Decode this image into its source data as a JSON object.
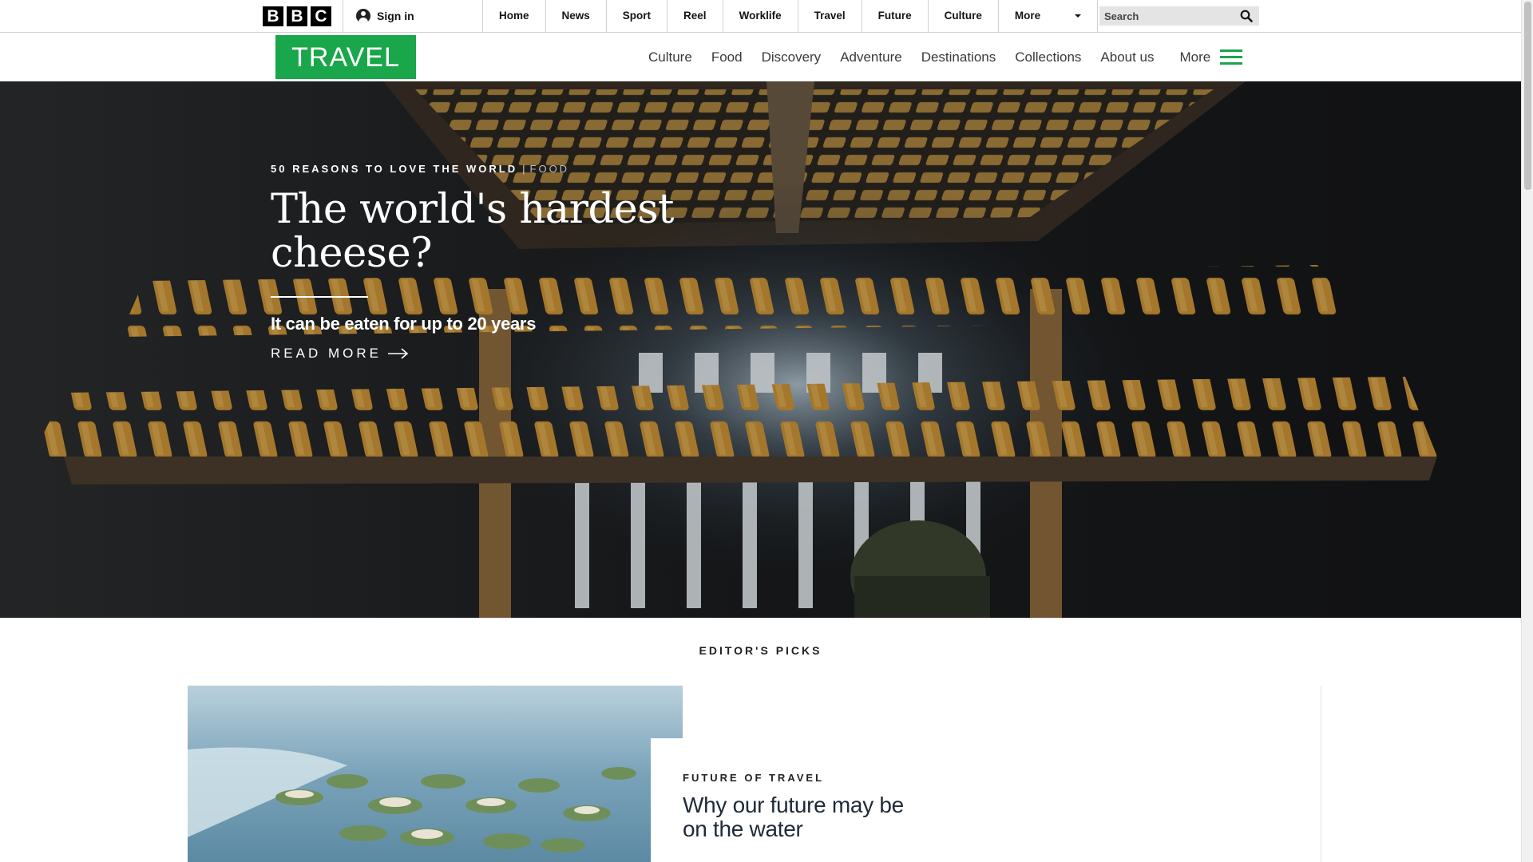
{
  "global_bar": {
    "logo_letters": [
      "B",
      "B",
      "C"
    ],
    "signin_label": "Sign in",
    "nav": [
      "Home",
      "News",
      "Sport",
      "Reel",
      "Worklife",
      "Travel",
      "Future",
      "Culture"
    ],
    "more_label": "More",
    "search_placeholder": "Search"
  },
  "travel_header": {
    "logo": "TRAVEL",
    "sections": [
      "Culture",
      "Food",
      "Discovery",
      "Adventure",
      "Destinations",
      "Collections",
      "About us"
    ],
    "more_label": "More",
    "accent_color": "#1aa64a"
  },
  "hero": {
    "kicker": "50 Reasons to Love the World",
    "separator": "|",
    "category": "Food",
    "title": "The world's hardest cheese?",
    "subtitle": "It can be eaten for up to 20 years",
    "cta": "READ MORE"
  },
  "editors_picks": {
    "heading": "EDITOR'S PICKS",
    "card": {
      "kicker": "FUTURE OF TRAVEL",
      "title": "Why our future may be on the water"
    }
  },
  "icons": {
    "search": "search-icon",
    "user": "user-icon",
    "menu": "hamburger-icon",
    "arrow": "arrow-right-icon"
  }
}
